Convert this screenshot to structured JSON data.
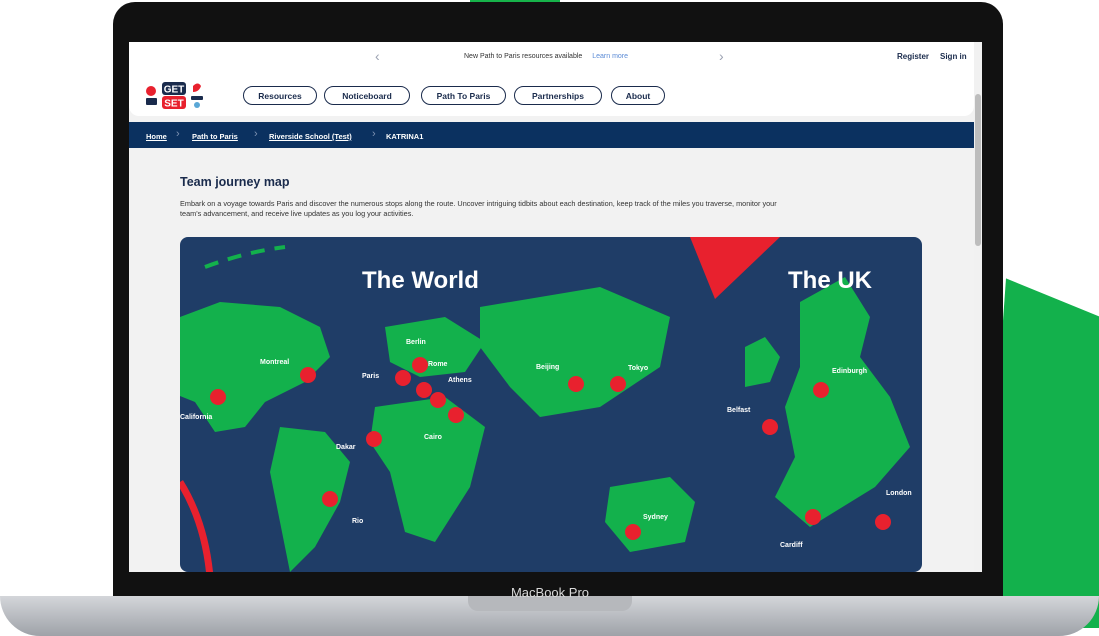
{
  "announcement": {
    "text": "New Path to Paris resources available",
    "link": "Learn more"
  },
  "auth": {
    "register": "Register",
    "sign_in": "Sign in"
  },
  "nav": {
    "items": [
      "Resources",
      "Noticeboard",
      "Path To Paris",
      "Partnerships",
      "About"
    ]
  },
  "breadcrumb": {
    "items": [
      "Home",
      "Path to Paris",
      "Riverside School (Test)",
      "KATRINA1"
    ]
  },
  "page": {
    "title": "Team journey map",
    "intro": "Embark on a voyage towards Paris and discover the numerous stops along the route. Uncover intriguing tidbits about each destination, keep track of the miles you traverse, monitor your team's advancement, and receive live updates as you log your activities."
  },
  "map": {
    "world_title": "The World",
    "uk_title": "The UK",
    "world_places": [
      "Montreal",
      "California",
      "Paris",
      "Berlin",
      "Rome",
      "Athens",
      "Cairo",
      "Dakar",
      "Rio",
      "Beijing",
      "Tokyo",
      "Sydney"
    ],
    "uk_places": [
      "Edinburgh",
      "Belfast",
      "Cardiff",
      "London"
    ]
  },
  "device": {
    "label": "MacBook Pro"
  },
  "logo": {
    "line1": "GET",
    "line2": "SET"
  },
  "colors": {
    "navy": "#1a2b4c",
    "breadcrumb_bg": "#0b3160",
    "map_bg": "#1f3d67",
    "land": "#13b14c",
    "pin": "#e8212e",
    "accent_green": "#13b14c"
  }
}
